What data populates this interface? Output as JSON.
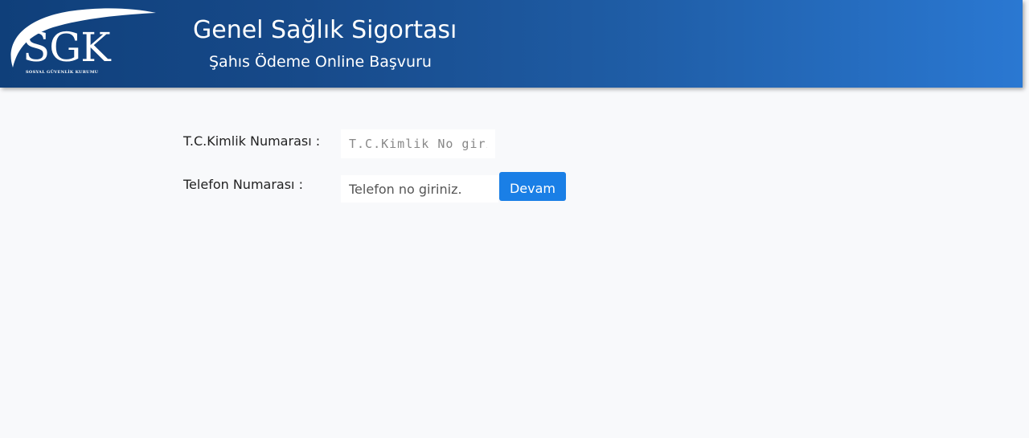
{
  "header": {
    "logo_text": "SGK",
    "logo_subtext": "SOSYAL GÜVENLİK KURUMU",
    "title": "Genel Sağlık Sigortası",
    "subtitle": "Şahıs Ödeme Online Başvuru"
  },
  "form": {
    "tc_label": "T.C.Kimlik Numarası :",
    "tc_placeholder": "T.C.Kimlik No giriniz.",
    "tc_value": "",
    "phone_label": "Telefon Numarası :",
    "phone_placeholder": "Telefon no giriniz.",
    "phone_value": "",
    "submit_label": "Devam"
  },
  "colors": {
    "header_start": "#0f3f7a",
    "header_end": "#2a78d2",
    "button": "#1a7fe6",
    "background": "#f8f9fb"
  },
  "icons": {
    "logo": "sgk-logo-swoosh"
  }
}
